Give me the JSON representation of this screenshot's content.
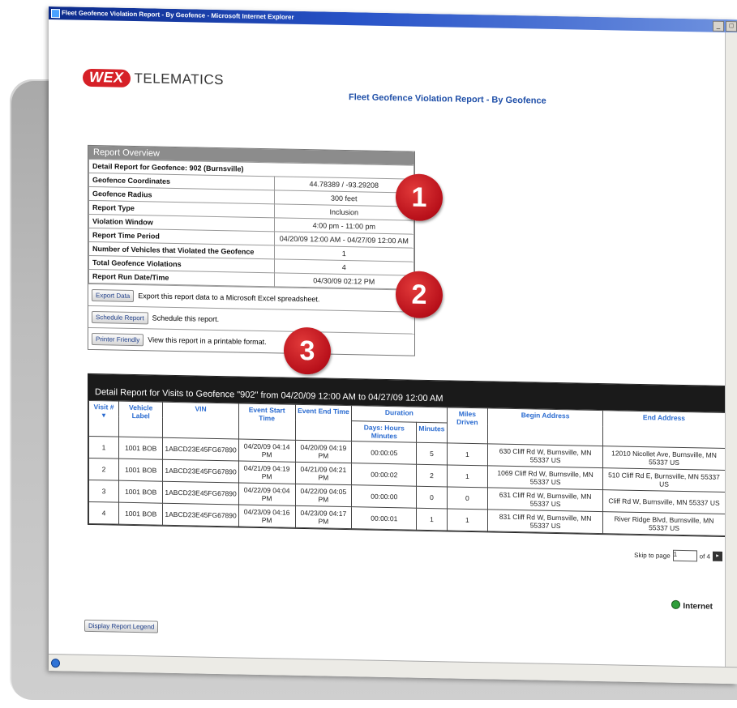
{
  "window": {
    "title": "Fleet Geofence Violation Report - By Geofence - Microsoft Internet Explorer"
  },
  "logo": {
    "mark": "WEX",
    "text": "TELEMATICS"
  },
  "report_title": "Fleet Geofence Violation Report - By Geofence",
  "overview": {
    "header": "Report Overview",
    "detail_title": "Detail Report for Geofence: 902 (Burnsville)",
    "rows": [
      {
        "label": "Geofence Coordinates",
        "value": "44.78389 / -93.29208"
      },
      {
        "label": "Geofence Radius",
        "value": "300 feet"
      },
      {
        "label": "Report Type",
        "value": "Inclusion"
      },
      {
        "label": "Violation Window",
        "value": "4:00 pm - 11:00 pm"
      },
      {
        "label": "Report Time Period",
        "value": "04/20/09 12:00 AM - 04/27/09 12:00 AM"
      },
      {
        "label": "Number of Vehicles that Violated the Geofence",
        "value": "1"
      },
      {
        "label": "Total Geofence Violations",
        "value": "4"
      },
      {
        "label": "Report Run Date/Time",
        "value": "04/30/09 02:12 PM"
      }
    ],
    "actions": [
      {
        "button": "Export Data",
        "text": "Export this report data to a Microsoft Excel spreadsheet."
      },
      {
        "button": "Schedule Report",
        "text": "Schedule this report."
      },
      {
        "button": "Printer Friendly",
        "text": "View this report in a printable format."
      }
    ]
  },
  "badges": [
    "1",
    "2",
    "3"
  ],
  "detail": {
    "title": "Detail Report for Visits to Geofence \"902\" from 04/20/09 12:00 AM to 04/27/09 12:00 AM",
    "headers": {
      "visit": "Visit #",
      "vehicle": "Vehicle Label",
      "vin": "VIN",
      "start": "Event Start Time",
      "end": "Event End Time",
      "duration": "Duration",
      "days_hours": "Days: Hours Minutes",
      "minutes": "Minutes",
      "miles": "Miles Driven",
      "begin_address": "Begin Address",
      "end_address": "End Address"
    },
    "rows": [
      {
        "visit": "1",
        "vehicle": "1001 BOB",
        "vin": "1ABCD23E45FG67890",
        "start": "04/20/09 04:14 PM",
        "end": "04/20/09 04:19 PM",
        "dh": "00:00:05",
        "min": "5",
        "miles": "1",
        "begin": "630 Cliff Rd W, Burnsville, MN 55337 US",
        "endaddr": "12010 Nicollet Ave, Burnsville, MN 55337 US"
      },
      {
        "visit": "2",
        "vehicle": "1001 BOB",
        "vin": "1ABCD23E45FG67890",
        "start": "04/21/09 04:19 PM",
        "end": "04/21/09 04:21 PM",
        "dh": "00:00:02",
        "min": "2",
        "miles": "1",
        "begin": "1069 Cliff Rd W, Burnsville, MN 55337 US",
        "endaddr": "510 Cliff Rd E, Burnsville, MN 55337 US"
      },
      {
        "visit": "3",
        "vehicle": "1001 BOB",
        "vin": "1ABCD23E45FG67890",
        "start": "04/22/09 04:04 PM",
        "end": "04/22/09 04:05 PM",
        "dh": "00:00:00",
        "min": "0",
        "miles": "0",
        "begin": "631 Cliff Rd W, Burnsville, MN 55337 US",
        "endaddr": "Cliff Rd W, Burnsville, MN 55337 US"
      },
      {
        "visit": "4",
        "vehicle": "1001 BOB",
        "vin": "1ABCD23E45FG67890",
        "start": "04/23/09 04:16 PM",
        "end": "04/23/09 04:17 PM",
        "dh": "00:00:01",
        "min": "1",
        "miles": "1",
        "begin": "831 Cliff Rd W, Burnsville, MN 55337 US",
        "endaddr": "River Ridge Blvd, Burnsville, MN 55337 US"
      }
    ],
    "pager": {
      "label": "Skip to page",
      "value": "1",
      "of": "of 4"
    }
  },
  "legend_button": "Display Report Legend",
  "status": {
    "zone": "Internet"
  },
  "colors": {
    "accent": "#d62027",
    "link": "#2a6bd0",
    "header_bg": "#1a1a1a"
  }
}
